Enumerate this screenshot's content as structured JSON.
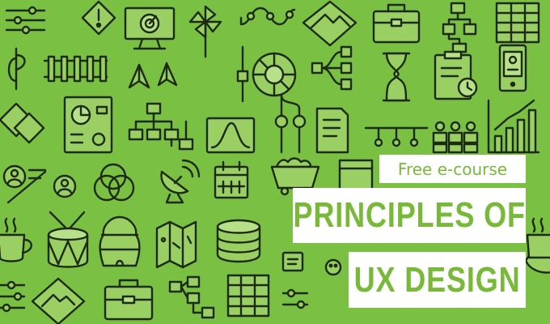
{
  "banner": {
    "background_color": "#7ac043",
    "accent_color": "#78b93a",
    "icon_stroke_color": "#1c2a10",
    "tag": "Free e-course",
    "title_line1": "PRINCIPLES OF",
    "title_line2": "UX DESIGN"
  },
  "icons": [
    "slider-controls-icon",
    "warning-icon",
    "monitor-target-icon",
    "pinwheel-icon",
    "flow-curve-icon",
    "mountain-icon",
    "briefcase-icon",
    "flowchart-icon",
    "spreadsheet-icon",
    "anchor-curve-icon",
    "railroad-track-icon",
    "paper-planes-icon",
    "vertical-slider-icon",
    "color-wheel-icon",
    "folders-icon",
    "mind-map-icon",
    "hourglass-icon",
    "clipboard-clock-icon",
    "mobile-app-icon",
    "grid-shapes-icon",
    "dashboard-document-icon",
    "org-chart-icon",
    "bell-curve-chart-icon",
    "user-journey-icon",
    "document-list-icon",
    "timeline-icon",
    "user-groups-icon",
    "growth-chart-icon",
    "user-profile-icon",
    "venn-diagram-icon",
    "satellite-dish-icon",
    "calendar-icon",
    "mine-cart-icon",
    "drum-icon",
    "beehive-icon",
    "folded-map-icon",
    "database-icon",
    "coffee-cup-icon"
  ]
}
